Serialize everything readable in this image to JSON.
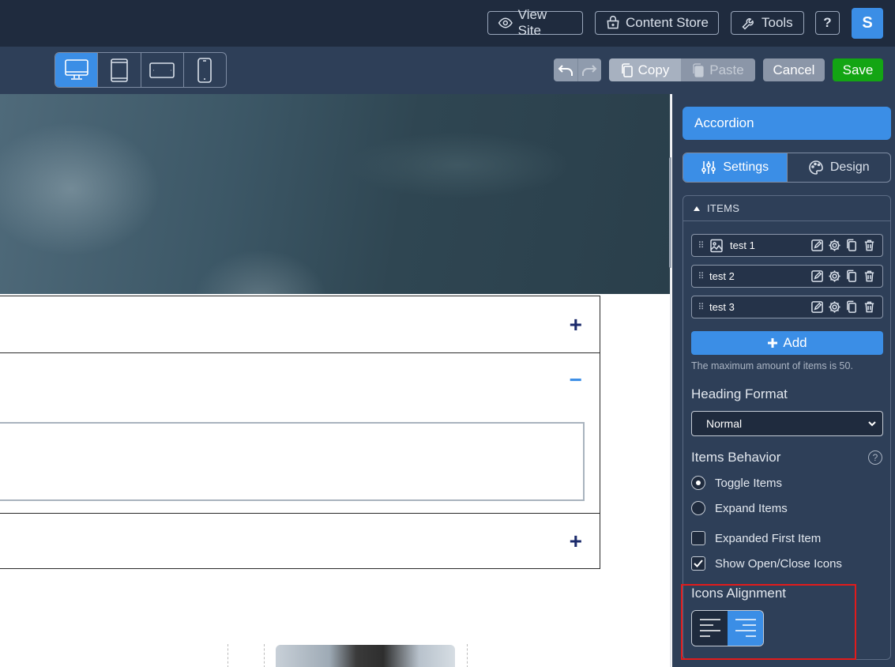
{
  "header": {
    "view_site": "View Site",
    "content_store": "Content Store",
    "tools": "Tools",
    "help": "?",
    "avatar_initial": "S",
    "accent": "#3b8ee6"
  },
  "toolbar": {
    "devices": [
      "desktop",
      "tablet-portrait",
      "tablet-landscape",
      "mobile"
    ],
    "active_device": "desktop",
    "copy": "Copy",
    "paste": "Paste",
    "cancel": "Cancel",
    "save": "Save",
    "save_color": "#13a513"
  },
  "canvas": {
    "accordion_icons": [
      "+",
      "−",
      "+"
    ],
    "expanded_index": 1
  },
  "panel": {
    "title": "Accordion",
    "tabs": [
      {
        "label": "Settings",
        "active": true
      },
      {
        "label": "Design",
        "active": false
      }
    ],
    "items_section": "ITEMS",
    "items": [
      {
        "label": "test 1",
        "has_image": true
      },
      {
        "label": "test 2",
        "has_image": false
      },
      {
        "label": "test 3",
        "has_image": false
      }
    ],
    "add_label": "Add",
    "max_note": "The maximum amount of items is 50.",
    "heading_format": {
      "label": "Heading Format",
      "value": "Normal"
    },
    "items_behavior": {
      "label": "Items Behavior",
      "help": "?",
      "options": [
        {
          "label": "Toggle Items",
          "selected": true
        },
        {
          "label": "Expand Items",
          "selected": false
        }
      ]
    },
    "checkboxes": [
      {
        "label": "Expanded First Item",
        "checked": false
      },
      {
        "label": "Show Open/Close Icons",
        "checked": true
      }
    ],
    "icons_alignment": {
      "label": "Icons Alignment",
      "options": [
        "left",
        "right"
      ],
      "selected": "right"
    }
  }
}
